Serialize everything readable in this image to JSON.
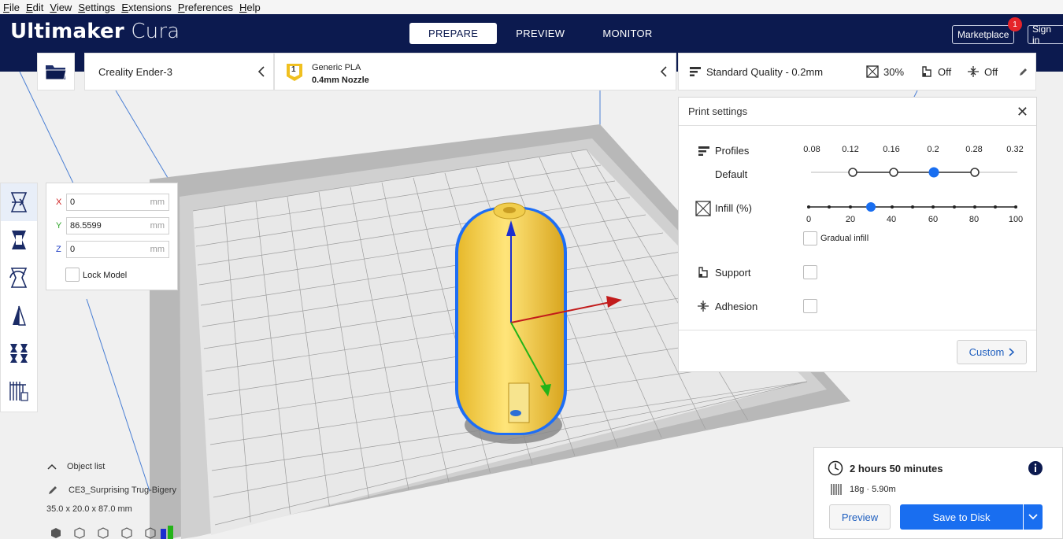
{
  "menu": [
    "File",
    "Edit",
    "View",
    "Settings",
    "Extensions",
    "Preferences",
    "Help"
  ],
  "app": {
    "brand_bold": "Ultimaker",
    "brand_light": "Cura"
  },
  "stages": [
    {
      "label": "PREPARE",
      "active": true
    },
    {
      "label": "PREVIEW",
      "active": false
    },
    {
      "label": "MONITOR",
      "active": false
    }
  ],
  "header": {
    "marketplace": "Marketplace",
    "marketplace_badge": "1",
    "signin": "Sign in"
  },
  "printer": {
    "name": "Creality Ender-3"
  },
  "material": {
    "slot": "1",
    "name": "Generic PLA",
    "nozzle": "0.4mm Nozzle"
  },
  "quality": {
    "profile": "Standard Quality - 0.2mm",
    "infill": "30%",
    "support": "Off",
    "adhesion": "Off"
  },
  "print_settings": {
    "title": "Print settings",
    "profiles_label": "Profiles",
    "default_label": "Default",
    "layer_heights": [
      "0.08",
      "0.12",
      "0.16",
      "0.2",
      "0.28",
      "0.32"
    ],
    "selected_layer_height": "0.2",
    "infill_label": "Infill (%)",
    "infill_ticks": [
      "0",
      "20",
      "40",
      "60",
      "80",
      "100"
    ],
    "infill_value": 30,
    "gradual_infill_label": "Gradual infill",
    "support_label": "Support",
    "adhesion_label": "Adhesion",
    "custom_button": "Custom"
  },
  "move_panel": {
    "x_label": "X",
    "x": "0",
    "y_label": "Y",
    "y": "86.5599",
    "z_label": "Z",
    "z": "0",
    "unit": "mm",
    "lock_label": "Lock Model"
  },
  "object_list": {
    "toggle_label": "Object list",
    "object_name": "CE3_Surprising Trug-Bigery",
    "dimensions": "35.0 x 20.0 x 87.0 mm"
  },
  "output": {
    "time": "2 hours 50 minutes",
    "material": "18g · 5.90m",
    "preview_button": "Preview",
    "save_button": "Save to Disk"
  },
  "colors": {
    "header": "#0c1a4f",
    "accent": "#196ef0",
    "model": "#f5d24a",
    "model_outline": "#1e6ef5"
  }
}
